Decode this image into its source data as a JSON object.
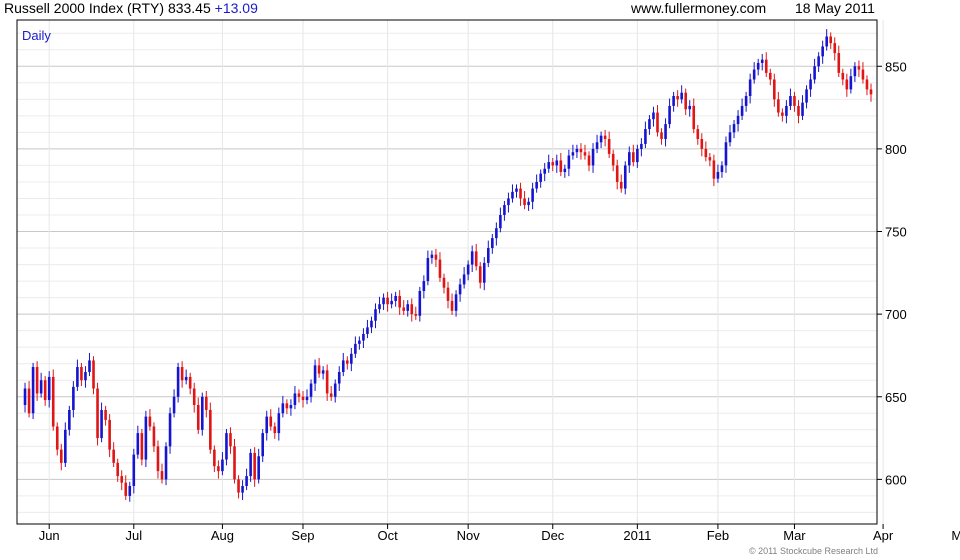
{
  "header": {
    "title": "Russell 2000 Index (RTY)",
    "last": "833.45",
    "change": "+13.09",
    "site": "www.fullermoney.com",
    "date": "18 May 2011"
  },
  "period_label": "Daily",
  "copyright": "© 2011 Stockcube Research Ltd",
  "chart_data": {
    "type": "candlestick",
    "title": "Russell 2000 Index (RTY)",
    "period": "Daily",
    "ylim": [
      573,
      878
    ],
    "y_ticks": [
      600,
      650,
      700,
      750,
      800,
      850
    ],
    "x_tick_labels": [
      "Jun",
      "Jul",
      "Aug",
      "Sep",
      "Oct",
      "Nov",
      "Dec",
      "2011",
      "Feb",
      "Mar",
      "Apr",
      "May"
    ],
    "x_tick_index": [
      7,
      28,
      50,
      70,
      91,
      111,
      132,
      153,
      173,
      192,
      214,
      234
    ],
    "grid": true,
    "up_color": "#1515d0",
    "down_color": "#e01515",
    "closes": [
      645,
      655,
      640,
      668,
      652,
      660,
      648,
      662,
      632,
      618,
      610,
      630,
      642,
      656,
      668,
      660,
      665,
      672,
      655,
      625,
      642,
      636,
      618,
      610,
      602,
      598,
      590,
      596,
      615,
      628,
      612,
      638,
      632,
      620,
      605,
      600,
      620,
      640,
      650,
      668,
      660,
      662,
      655,
      645,
      630,
      650,
      642,
      618,
      608,
      605,
      612,
      628,
      620,
      600,
      592,
      596,
      602,
      616,
      600,
      614,
      628,
      638,
      632,
      628,
      640,
      646,
      643,
      645,
      652,
      650,
      648,
      650,
      658,
      669,
      664,
      666,
      652,
      650,
      658,
      665,
      672,
      670,
      676,
      682,
      684,
      688,
      692,
      696,
      703,
      706,
      710,
      706,
      708,
      711,
      704,
      702,
      706,
      700,
      699,
      714,
      720,
      734,
      736,
      733,
      722,
      716,
      708,
      702,
      712,
      718,
      724,
      730,
      738,
      729,
      719,
      731,
      740,
      746,
      752,
      760,
      766,
      770,
      774,
      776,
      770,
      766,
      768,
      776,
      780,
      785,
      788,
      792,
      790,
      793,
      786,
      788,
      796,
      798,
      800,
      798,
      796,
      790,
      800,
      804,
      808,
      806,
      797,
      790,
      780,
      776,
      790,
      798,
      792,
      800,
      803,
      812,
      818,
      822,
      810,
      806,
      815,
      826,
      832,
      830,
      834,
      824,
      826,
      812,
      806,
      800,
      795,
      793,
      782,
      786,
      790,
      804,
      810,
      815,
      820,
      826,
      832,
      842,
      848,
      852,
      854,
      846,
      842,
      830,
      822,
      820,
      826,
      832,
      826,
      820,
      828,
      836,
      842,
      850,
      856,
      862,
      868,
      864,
      858,
      846,
      842,
      836,
      844,
      850,
      848,
      842,
      836,
      833
    ]
  }
}
